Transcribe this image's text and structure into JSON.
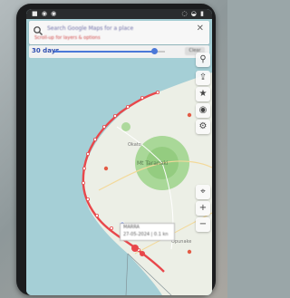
{
  "status_bar": {
    "left_icons": "■ ◉ ◉",
    "right_icons": "◌ ◒ ▮"
  },
  "search": {
    "placeholder": "Search Google Maps for a place",
    "subtitle": "Scroll-up for layers & options"
  },
  "time_filter": {
    "label": "30 days",
    "filter_label": "Clear",
    "slider_value": 0.9
  },
  "map": {
    "place_label": "Mt Taranaki",
    "town_labels": [
      "Okato",
      "Opunake"
    ],
    "track_popup": {
      "title": "MARRA",
      "subtitle": "27-05-2024 | 0.1 kn"
    },
    "colors": {
      "sea": "#a5cfd6",
      "land": "#ecefe6",
      "track": "#e8474b",
      "park": "#9ed38a"
    }
  },
  "toolbar": {
    "items": [
      {
        "icon": "map-pin-icon",
        "glyph": "⚲"
      },
      {
        "icon": "share-icon",
        "glyph": "⇪"
      },
      {
        "icon": "star-icon",
        "glyph": "★"
      },
      {
        "icon": "layers-icon",
        "glyph": "◉"
      },
      {
        "icon": "settings-icon",
        "glyph": "⚙"
      },
      {
        "icon": "location-icon",
        "glyph": "⌖"
      },
      {
        "icon": "zoom-in-icon",
        "glyph": "+"
      },
      {
        "icon": "zoom-out-icon",
        "glyph": "−"
      }
    ]
  }
}
